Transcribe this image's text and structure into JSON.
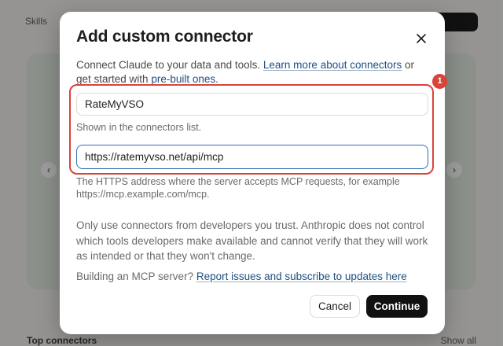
{
  "background": {
    "skills_label": "Skills",
    "bottom_heading": "Top connectors",
    "show_all": "Show all"
  },
  "modal": {
    "title": "Add custom connector",
    "intro_text": "Connect Claude to your data and tools. ",
    "learn_more_link": "Learn more about connectors",
    "intro_or": " or get started with ",
    "prebuilt_link": "pre-built ones",
    "intro_end": ".",
    "name_value": "RateMyVSO",
    "name_hint": "Shown in the connectors list.",
    "url_value": "https://ratemyvso.net/api/mcp",
    "url_hint": "The HTTPS address where the server accepts MCP requests, for example https://mcp.example.com/mcp.",
    "warning": "Only use connectors from developers you trust. Anthropic does not control which tools developers make available and cannot verify that they will work as intended or that they won't change.",
    "building_text": "Building an MCP server? ",
    "report_link": "Report issues and subscribe to updates here",
    "cancel_label": "Cancel",
    "continue_label": "Continue"
  },
  "annotation": {
    "badge": "1",
    "color": "#d9443a"
  },
  "icons": {
    "close": "close-icon",
    "prev": "chevron-left-icon",
    "next": "chevron-right-icon"
  }
}
